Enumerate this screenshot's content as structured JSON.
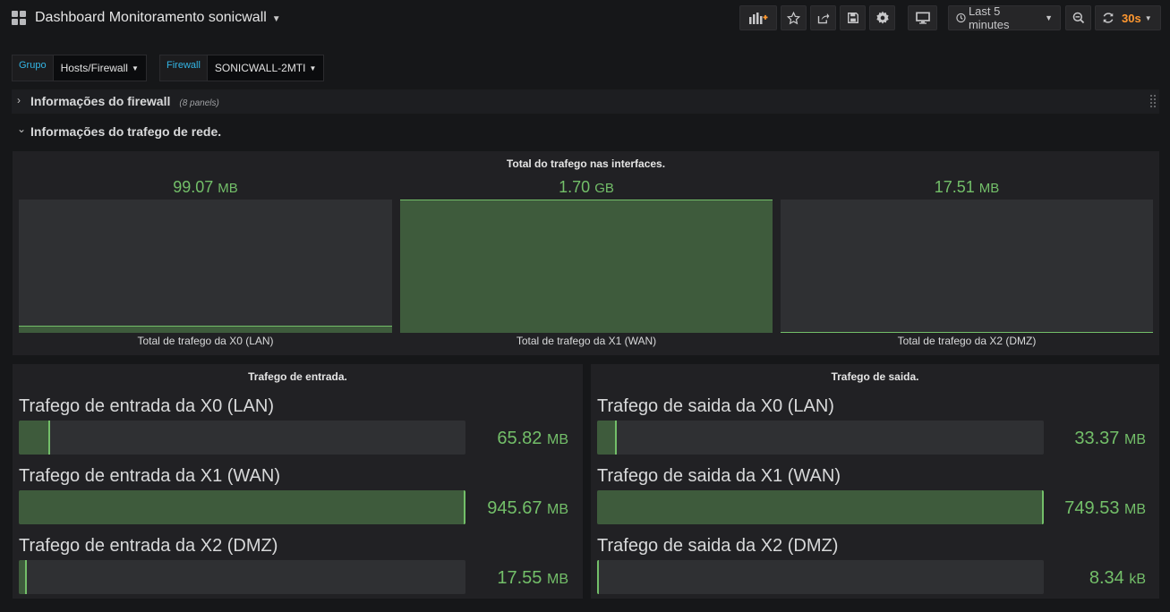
{
  "header": {
    "title": "Dashboard Monitoramento sonicwall",
    "time_range": "Last 5 minutes",
    "refresh_interval": "30s"
  },
  "variables": [
    {
      "label": "Grupo",
      "value": "Hosts/Firewall"
    },
    {
      "label": "Firewall",
      "value": "SONICWALL-2MTI"
    }
  ],
  "rows": [
    {
      "title": "Informações do firewall",
      "count": "(8 panels)",
      "collapsed": true
    },
    {
      "title": "Informações do trafego de rede.",
      "collapsed": false
    }
  ],
  "total_panel": {
    "title": "Total do trafego nas interfaces.",
    "gauges": [
      {
        "label": "Total de trafego da X0 (LAN)",
        "value": "99.07",
        "unit": "MB",
        "fraction": 0.057
      },
      {
        "label": "Total de trafego da X1 (WAN)",
        "value": "1.70",
        "unit": "GB",
        "fraction": 1.0
      },
      {
        "label": "Total de trafego da X2 (DMZ)",
        "value": "17.51",
        "unit": "MB",
        "fraction": 0.01
      }
    ]
  },
  "inbound_panel": {
    "title": "Trafego de entrada.",
    "bars": [
      {
        "label": "Trafego de entrada da X0 (LAN)",
        "value": "65.82",
        "unit": "MB",
        "fraction": 0.07
      },
      {
        "label": "Trafego de entrada da X1 (WAN)",
        "value": "945.67",
        "unit": "MB",
        "fraction": 1.0
      },
      {
        "label": "Trafego de entrada da X2 (DMZ)",
        "value": "17.55",
        "unit": "MB",
        "fraction": 0.019
      }
    ]
  },
  "outbound_panel": {
    "title": "Trafego de saida.",
    "bars": [
      {
        "label": "Trafego de saida da X0 (LAN)",
        "value": "33.37",
        "unit": "MB",
        "fraction": 0.045
      },
      {
        "label": "Trafego de saida da X1 (WAN)",
        "value": "749.53",
        "unit": "MB",
        "fraction": 1.0
      },
      {
        "label": "Trafego de saida da X2 (DMZ)",
        "value": "8.34",
        "unit": "kB",
        "fraction": 0.0
      }
    ]
  },
  "colors": {
    "accent_green": "#73bf69",
    "fill_green": "#3e5b3c",
    "refresh_orange": "#ff9830",
    "var_label_blue": "#33b5e5"
  }
}
